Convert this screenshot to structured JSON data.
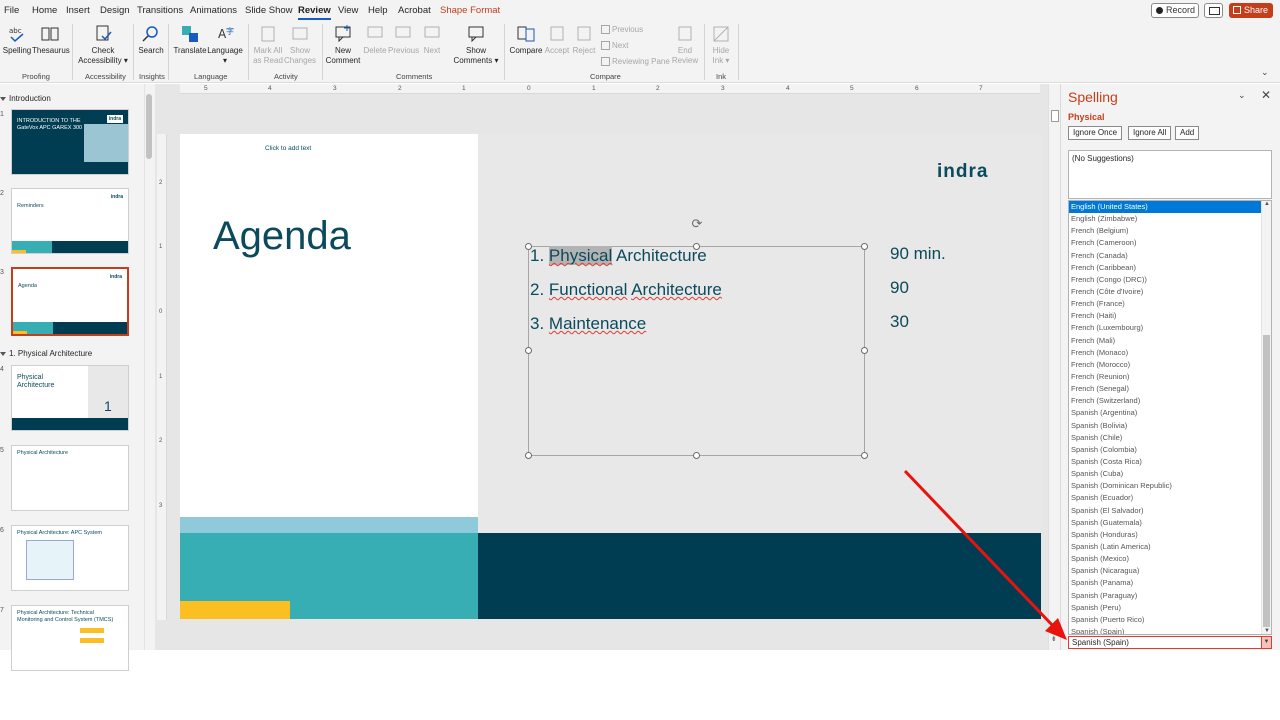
{
  "menu": {
    "tabs": [
      "File",
      "Home",
      "Insert",
      "Design",
      "Transitions",
      "Animations",
      "Slide Show",
      "Review",
      "View",
      "Help",
      "Acrobat",
      "Shape Format"
    ],
    "active_tab": "Review",
    "record_label": "Record",
    "share_label": "Share"
  },
  "ribbon": {
    "spelling": "Spelling",
    "thesaurus": "Thesaurus",
    "check_accessibility_1": "Check",
    "check_accessibility_2": "Accessibility",
    "search": "Search",
    "translate": "Translate",
    "language": "Language",
    "mark_all_1": "Mark All",
    "mark_all_2": "as Read",
    "show_changes_1": "Show",
    "show_changes_2": "Changes",
    "new_comment_1": "New",
    "new_comment_2": "Comment",
    "delete": "Delete",
    "previous": "Previous",
    "next": "Next",
    "show_comments_1": "Show",
    "show_comments_2": "Comments",
    "compare": "Compare",
    "accept": "Accept",
    "reject": "Reject",
    "cmp_previous": "Previous",
    "cmp_next": "Next",
    "reviewing_pane": "Reviewing Pane",
    "end_review_1": "End",
    "end_review_2": "Review",
    "hide_ink_1": "Hide",
    "hide_ink_2": "Ink",
    "groups": {
      "proofing": "Proofing",
      "accessibility": "Accessibility",
      "insights": "Insights",
      "language": "Language",
      "activity": "Activity",
      "comments": "Comments",
      "compare": "Compare",
      "ink": "Ink"
    }
  },
  "thumbnails": {
    "section_intro": "Introduction",
    "section_phys": "1. Physical Architecture",
    "slides": [
      {
        "num": "1",
        "title": "INTRODUCTION TO THE GateVox APC GAREX 300"
      },
      {
        "num": "2",
        "title": "Reminders"
      },
      {
        "num": "3",
        "title": "Agenda"
      },
      {
        "num": "4",
        "title": "Physical Architecture",
        "big": "1"
      },
      {
        "num": "5",
        "title": "Physical Architecture"
      },
      {
        "num": "6",
        "title": "Physical Architecture: APC System"
      },
      {
        "num": "7",
        "title": "Physical Architecture: Technical Monitoring and Control System (TMCS)"
      }
    ],
    "brand": "indra"
  },
  "ruler_h": [
    "5",
    "4",
    "3",
    "2",
    "1",
    "0",
    "1",
    "2",
    "3",
    "4",
    "5",
    "6",
    "7"
  ],
  "ruler_v": [
    "2",
    "1",
    "0",
    "1",
    "2",
    "3"
  ],
  "slide": {
    "click_to_add": "Click to add text",
    "title": "Agenda",
    "brand": "indra",
    "items": [
      {
        "num": "1.",
        "word": "Physical",
        "rest": "Architecture",
        "duration": "90 min."
      },
      {
        "num": "2.",
        "word": "Functional",
        "rest": "Architecture",
        "duration": "90"
      },
      {
        "num": "3.",
        "word": "Maintenance",
        "rest": "",
        "duration": "30"
      }
    ]
  },
  "spelling": {
    "title": "Spelling",
    "word": "Physical",
    "ignore_once": "Ignore Once",
    "ignore_all": "Ignore All",
    "add": "Add",
    "no_suggestions": "(No Suggestions)",
    "languages": [
      "English (United States)",
      "English (Zimbabwe)",
      "French (Belgium)",
      "French (Cameroon)",
      "French (Canada)",
      "French (Caribbean)",
      "French (Congo (DRC))",
      "French (Côte d'Ivoire)",
      "French (France)",
      "French (Haiti)",
      "French (Luxembourg)",
      "French (Mali)",
      "French (Monaco)",
      "French (Morocco)",
      "French (Reunion)",
      "French (Senegal)",
      "French (Switzerland)",
      "Spanish (Argentina)",
      "Spanish (Bolivia)",
      "Spanish (Chile)",
      "Spanish (Colombia)",
      "Spanish (Costa Rica)",
      "Spanish (Cuba)",
      "Spanish (Dominican Republic)",
      "Spanish (Ecuador)",
      "Spanish (El Salvador)",
      "Spanish (Guatemala)",
      "Spanish (Honduras)",
      "Spanish (Latin America)",
      "Spanish (Mexico)",
      "Spanish (Nicaragua)",
      "Spanish (Panama)",
      "Spanish (Paraguay)",
      "Spanish (Peru)",
      "Spanish (Puerto Rico)",
      "Spanish (Spain)"
    ],
    "selected_language": "Spanish (Spain)"
  },
  "colors": {
    "accent": "#c43e1c",
    "brand_dark": "#003d52",
    "brand_teal": "#37adb4",
    "brand_yellow": "#fbbf24",
    "selection": "#0078d7",
    "annotation_arrow": "#e8130c"
  },
  "icons": [
    "record-dot-icon",
    "comment-icon",
    "share-icon",
    "abc-check-icon",
    "book-icon",
    "accessibility-icon",
    "search-icon",
    "translate-icon",
    "language-icon",
    "close-icon",
    "chevron-down-icon",
    "rotate-icon"
  ]
}
